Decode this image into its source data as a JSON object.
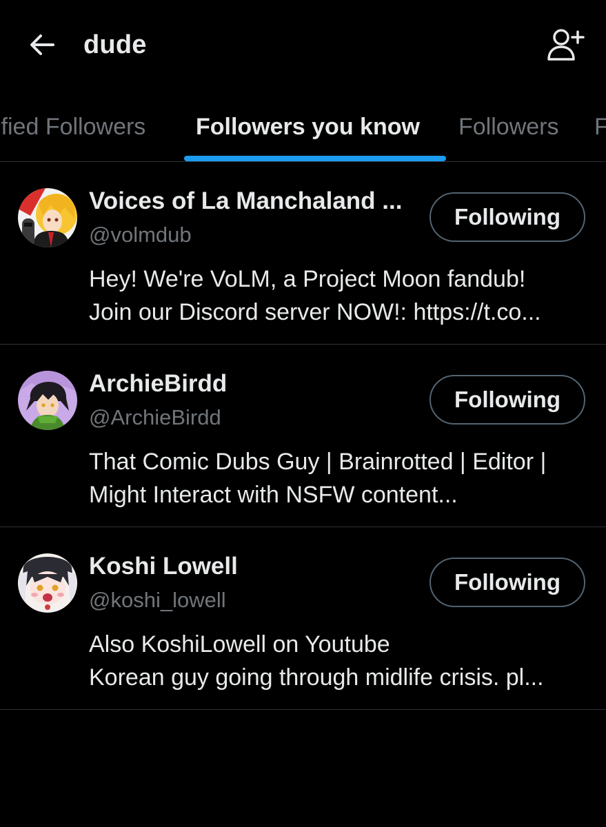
{
  "header": {
    "title": "dude",
    "back_icon": "arrow-left-icon",
    "add_user_icon": "person-plus-icon"
  },
  "tabs": [
    {
      "label": "ified Followers",
      "active": false
    },
    {
      "label": "Followers you know",
      "active": true
    },
    {
      "label": "Followers",
      "active": false
    },
    {
      "label": "F",
      "active": false
    }
  ],
  "colors": {
    "background": "#000000",
    "text_primary": "#e7e9ea",
    "text_secondary": "#71767b",
    "accent": "#1d9bf0",
    "divider": "#2f3336"
  },
  "users": [
    {
      "name": "Voices of La Manchaland ...",
      "handle": "@volmdub",
      "button": "Following",
      "bio_line1": "Hey! We're VoLM, a Project Moon fandub!",
      "bio_line2": "Join our Discord server NOW!: https://t.co..."
    },
    {
      "name": "ArchieBirdd",
      "handle": "@ArchieBirdd",
      "button": "Following",
      "bio_line1": "That Comic Dubs Guy | Brainrotted | Editor |",
      "bio_line2": "Might Interact with NSFW content..."
    },
    {
      "name": "Koshi Lowell",
      "handle": "@koshi_lowell",
      "button": "Following",
      "bio_line1": "Also KoshiLowell on Youtube",
      "bio_line2": "Korean guy going through midlife crisis. pl..."
    }
  ]
}
